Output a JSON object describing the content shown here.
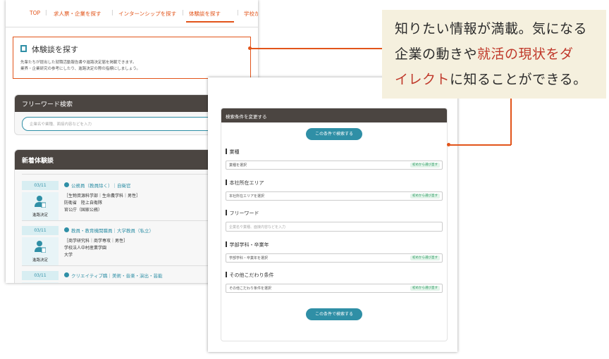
{
  "nav": {
    "items": [
      "TOP",
      "求人票・企業を探す",
      "インターンシップを探す",
      "体験談を探す",
      "学校からの"
    ],
    "active": "体験談を探す"
  },
  "search_header": {
    "title": "体験談を探す",
    "desc_line1": "先輩たちが提出した就職活動報告書や進路決定届を掲載できます。",
    "desc_line2": "業界・企業研究の参考にしたり、進路決定の際の指標にしましょう。"
  },
  "free_word": {
    "heading": "フリーワード検索",
    "placeholder": "企業名や業種、面接内容などを入力"
  },
  "new_reports": {
    "heading": "新着体験談",
    "entries": [
      {
        "date": "03/11",
        "tag": "進路決定",
        "title": "公務員（教員除く）｜自衛官",
        "line1": "［生物資源科学部｜生命農学科｜男性］",
        "line2": "防衛省　陸上自衛隊",
        "line3": "官公庁（国家公務）"
      },
      {
        "date": "03/11",
        "tag": "進路決定",
        "title": "教員・教育機関職員｜大学教員（私立）",
        "line1": "［商学研究科｜商学専攻｜男性］",
        "line2": "学校法人中村産業学園",
        "line3": "大学"
      },
      {
        "date": "03/11",
        "title": "クリエイティブ職｜美術・音楽・演出・芸能"
      }
    ]
  },
  "change_panel": {
    "heading": "検索条件を変更する",
    "search_button": "この条件で検索する",
    "fields": [
      {
        "label": "業種",
        "value": "業種を選択",
        "badge": "初めから選び直す"
      },
      {
        "label": "本社所在エリア",
        "value": "本社所在エリアを選択",
        "badge": "初めから選び直す"
      },
      {
        "label": "フリーワード",
        "placeholder": "企業名や業種、面接内容などを入力"
      },
      {
        "label": "学部学科・卒業年",
        "value": "学部学科・卒業年を選択",
        "badge": "初めから選び直す"
      },
      {
        "label": "その他こだわり条件",
        "value": "その他こだわり条件を選択",
        "badge": "初めから選び直す"
      }
    ]
  },
  "callout": {
    "line1": "知りたい情報が満載。気になる",
    "line2_a": "企業の動きや",
    "line2_b": "就活の現状をダ",
    "line3_a": "イレクト",
    "line3_b": "に知ることができる。"
  },
  "colors": {
    "accent": "#e2541a",
    "teal": "#2f8fa6",
    "header_dark": "#4b4541",
    "callout_bg": "#f5f0de",
    "highlight_red": "#c0392b"
  }
}
